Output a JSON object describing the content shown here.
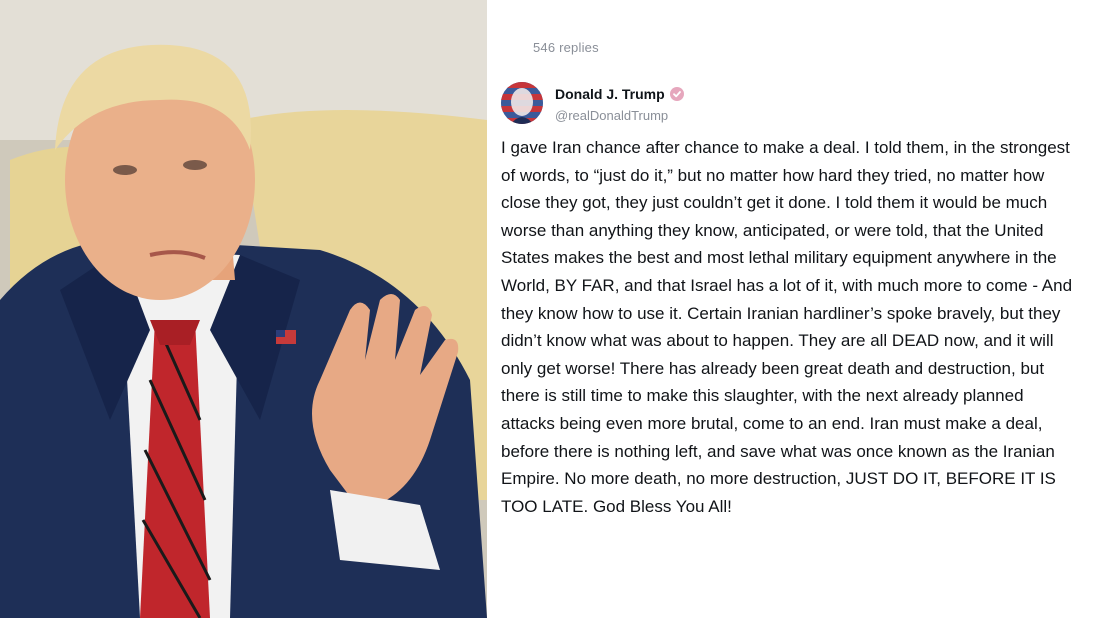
{
  "post": {
    "replies_count": "546 replies",
    "author": {
      "display_name": "Donald J. Trump",
      "handle": "@realDonaldTrump",
      "verified": true,
      "avatar_icon": "flag-portrait-avatar"
    },
    "text": "I gave Iran chance after chance to make a deal. I told them, in the strongest of words, to “just do it,” but no matter how hard they tried, no matter how close they got, they just couldn’t get it done. I told them it would be much worse than anything they know, anticipated, or were told, that the United States makes the best and most lethal military equipment anywhere in the World, BY FAR, and that Israel has a lot of it, with much more to come - And they know how to use it. Certain Iranian hardliner’s spoke bravely, but they didn’t know what was about to happen. They are all DEAD now, and it will only get worse! There has already been great death and destruction, but there is still time to make this slaughter, with the next already planned attacks being even more brutal, come to an end. Iran must make a deal, before there is nothing left, and save what was once known as the Iranian Empire. No more death, no more destruction, JUST DO IT, BEFORE IT IS TOO LATE. God Bless You All!"
  },
  "colors": {
    "verified_badge": "#e6a7bd",
    "secondary_text": "#8a8f98",
    "primary_text": "#111418"
  }
}
